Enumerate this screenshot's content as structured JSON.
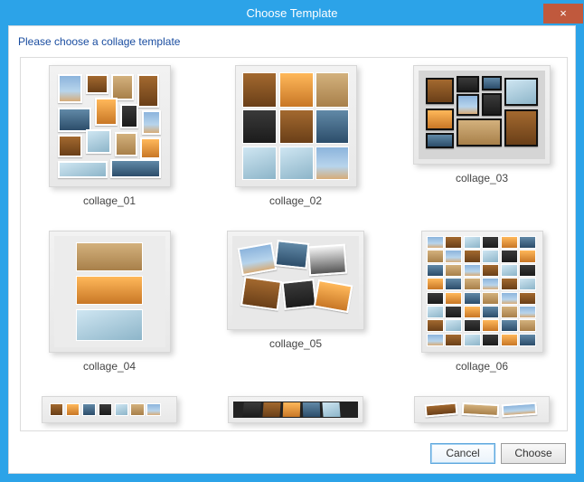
{
  "window": {
    "title": "Choose Template",
    "close_glyph": "×"
  },
  "instruction": "Please choose a collage template",
  "templates": [
    {
      "label": "collage_01"
    },
    {
      "label": "collage_02"
    },
    {
      "label": "collage_03"
    },
    {
      "label": "collage_04"
    },
    {
      "label": "collage_05"
    },
    {
      "label": "collage_06"
    }
  ],
  "buttons": {
    "cancel": "Cancel",
    "choose": "Choose"
  }
}
